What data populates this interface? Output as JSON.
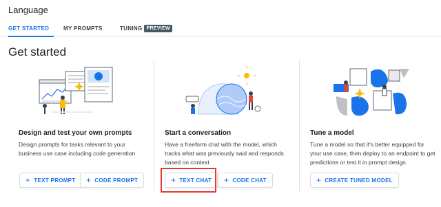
{
  "app": {
    "title": "Language"
  },
  "tabs": [
    {
      "label": "GET STARTED"
    },
    {
      "label": "MY PROMPTS"
    },
    {
      "label": "TUNING",
      "badge": "PREVIEW"
    }
  ],
  "page": {
    "title": "Get started"
  },
  "cards": [
    {
      "title": "Design and test your own prompts",
      "description": "Design prompts for tasks relevant to your business use case including code generation",
      "buttons": [
        "TEXT PROMPT",
        "CODE PROMPT"
      ]
    },
    {
      "title": "Start a conversation",
      "description": "Have a freeform chat with the model, which tracks what was previously said and responds based on context",
      "buttons": [
        "TEXT CHAT",
        "CODE CHAT"
      ]
    },
    {
      "title": "Tune a model",
      "description": "Tune a model so that it's better equipped for your use case, then deploy to an endpoint to get predictions or test it in prompt design",
      "buttons": [
        "CREATE TUNED MODEL"
      ]
    }
  ],
  "icons": {
    "button_icon": "plus-icon"
  },
  "colors": {
    "accent": "#1a73e8",
    "highlight": "#e53935",
    "badge_bg": "#455a64"
  }
}
